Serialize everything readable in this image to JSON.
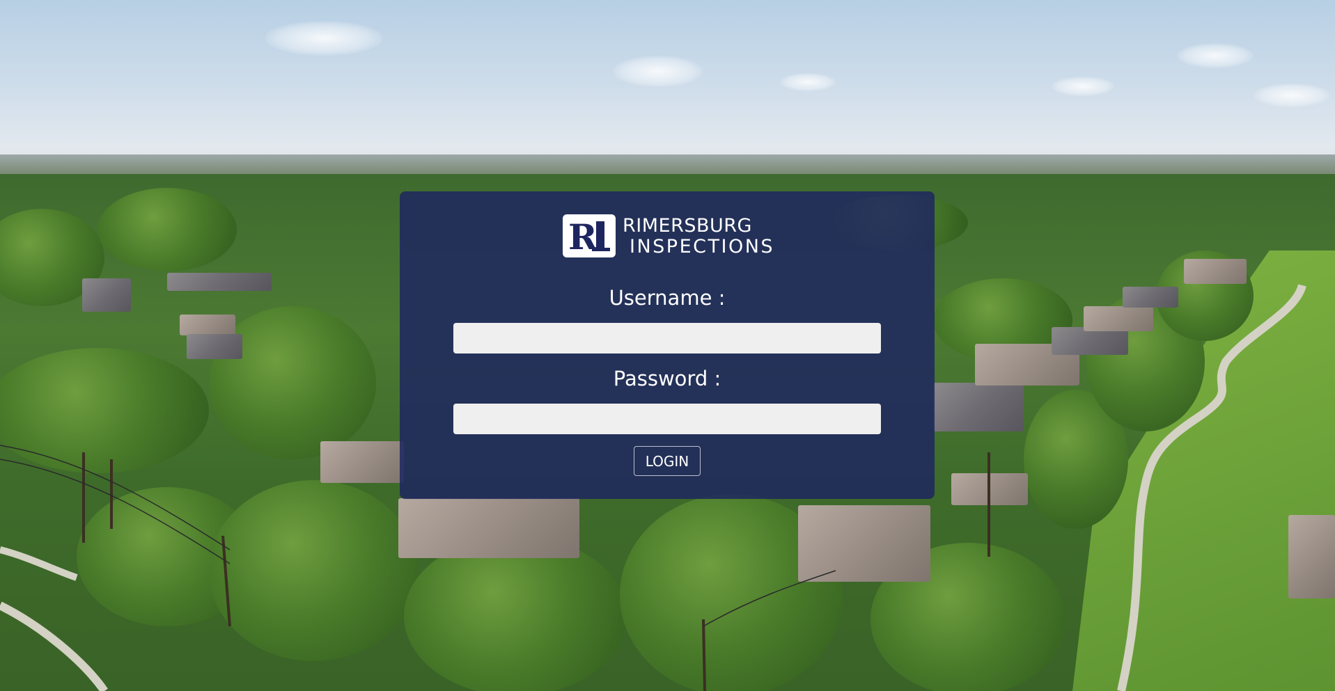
{
  "brand": {
    "line1": "RIMERSBURG",
    "line2": "INSPECTIONS",
    "monogram": "RI"
  },
  "login_form": {
    "username_label": "Username :",
    "password_label": "Password :",
    "username_value": "",
    "password_value": "",
    "login_button": "LOGIN"
  },
  "colors": {
    "panel": "#1e2660",
    "input_bg": "#efefef",
    "text": "#ffffff"
  }
}
